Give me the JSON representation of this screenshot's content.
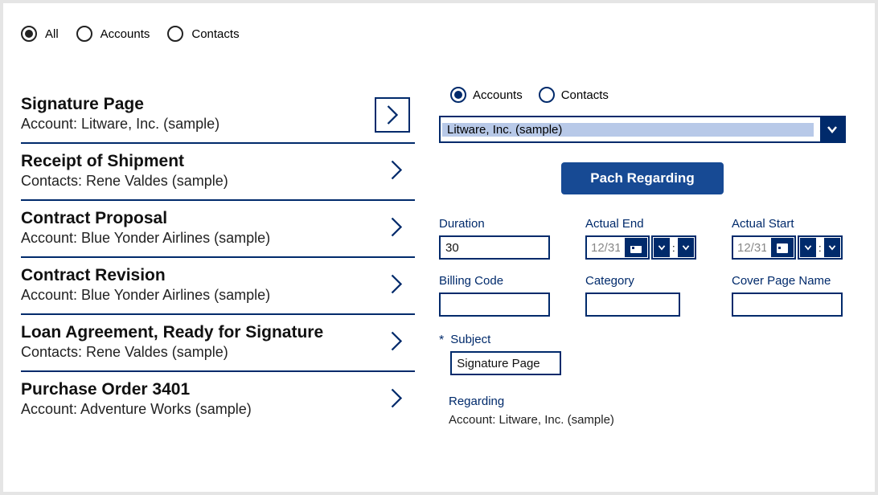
{
  "filters": {
    "all": "All",
    "accounts": "Accounts",
    "contacts": "Contacts"
  },
  "list": [
    {
      "title": "Signature Page",
      "sub": "Account: Litware, Inc. (sample)"
    },
    {
      "title": "Receipt of Shipment",
      "sub": "Contacts: Rene Valdes (sample)"
    },
    {
      "title": "Contract Proposal",
      "sub": "Account: Blue Yonder Airlines (sample)"
    },
    {
      "title": "Contract Revision",
      "sub": "Account: Blue Yonder Airlines (sample)"
    },
    {
      "title": "Loan Agreement, Ready for Signature",
      "sub": "Contacts: Rene Valdes (sample)"
    },
    {
      "title": "Purchase Order 3401",
      "sub": "Account: Adventure Works (sample)"
    }
  ],
  "panel": {
    "radios": {
      "accounts": "Accounts",
      "contacts": "Contacts"
    },
    "dropdown_value": "Litware, Inc. (sample)",
    "button": "Pach Regarding",
    "fields": {
      "duration": {
        "label": "Duration",
        "value": "30"
      },
      "actual_end": {
        "label": "Actual End",
        "value": "12/31"
      },
      "actual_start": {
        "label": "Actual Start",
        "value": "12/31"
      },
      "billing_code": {
        "label": "Billing Code",
        "value": ""
      },
      "category": {
        "label": "Category",
        "value": ""
      },
      "cover_page_name": {
        "label": "Cover Page Name",
        "value": ""
      },
      "subject": {
        "label": "Subject",
        "value": "Signature Page"
      }
    },
    "regarding": {
      "label": "Regarding",
      "value": "Account: Litware, Inc. (sample)"
    }
  }
}
